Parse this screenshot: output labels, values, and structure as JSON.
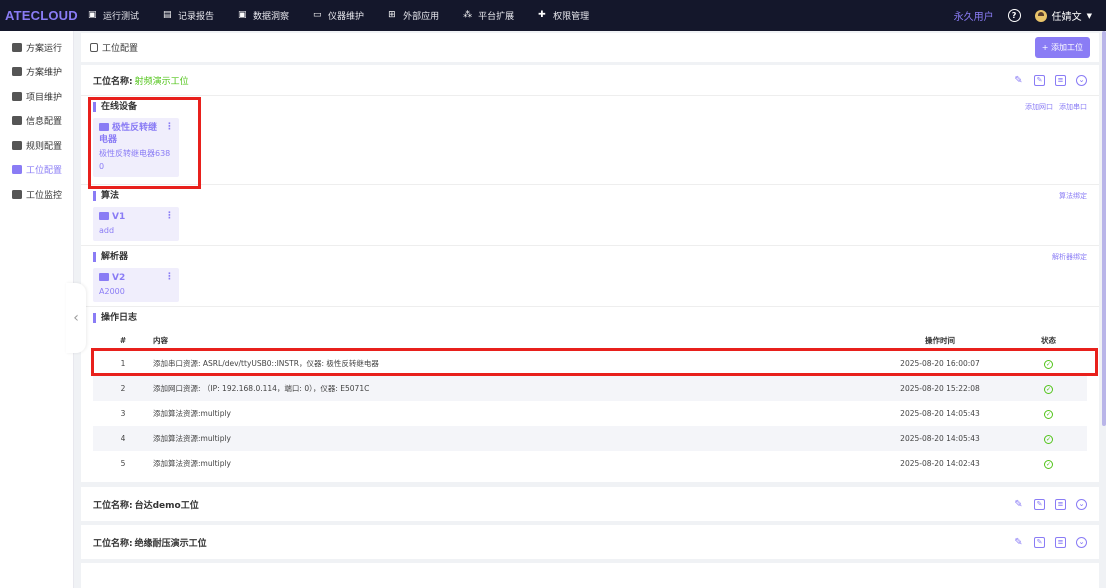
{
  "app": {
    "logo": "ATECLOUD"
  },
  "topnav": [
    {
      "label": "运行测试",
      "icon": "monitor-icon"
    },
    {
      "label": "记录报告",
      "icon": "document-icon"
    },
    {
      "label": "数据洞察",
      "icon": "chart-monitor-icon"
    },
    {
      "label": "仪器维护",
      "icon": "instrument-icon"
    },
    {
      "label": "外部应用",
      "icon": "grid-icon"
    },
    {
      "label": "平台扩展",
      "icon": "nodes-icon"
    },
    {
      "label": "权限管理",
      "icon": "plus-cluster-icon"
    }
  ],
  "user": {
    "type": "永久用户",
    "name": "任婧文"
  },
  "sidebar": [
    {
      "label": "方案运行",
      "active": false
    },
    {
      "label": "方案维护",
      "active": false
    },
    {
      "label": "项目维护",
      "active": false
    },
    {
      "label": "信息配置",
      "active": false
    },
    {
      "label": "规则配置",
      "active": false
    },
    {
      "label": "工位配置",
      "active": true
    },
    {
      "label": "工位监控",
      "active": false
    }
  ],
  "breadcrumb": {
    "label": "工位配置"
  },
  "add_station_label": "+ 添加工位",
  "station_label": "工位名称:",
  "stations": [
    {
      "name": "射频演示工位",
      "sections": {
        "online_devices": {
          "title": "在线设备",
          "links": [
            "添加网口",
            "添加串口"
          ],
          "card": {
            "title": "极性反转继电器",
            "sub": "极性反转继电器6380"
          }
        },
        "algorithm": {
          "title": "算法",
          "links": [
            "算法绑定"
          ],
          "card": {
            "title": "V1",
            "sub": "add"
          }
        },
        "parser": {
          "title": "解析器",
          "links": [
            "解析器绑定"
          ],
          "card": {
            "title": "V2",
            "sub": "A2000"
          }
        },
        "log": {
          "title": "操作日志",
          "columns": [
            "#",
            "内容",
            "操作时间",
            "状态"
          ],
          "rows": [
            {
              "no": "1",
              "content": "添加串口资源: ASRL/dev/ttyUSB0::INSTR，仪器: 极性反转继电器",
              "time": "2025-08-20 16:00:07"
            },
            {
              "no": "2",
              "content": "添加网口资源: （IP: 192.168.0.114，端口: 0），仪器: E5071C",
              "time": "2025-08-20 15:22:08"
            },
            {
              "no": "3",
              "content": "添加算法资源:multiply",
              "time": "2025-08-20 14:05:43"
            },
            {
              "no": "4",
              "content": "添加算法资源:multiply",
              "time": "2025-08-20 14:05:43"
            },
            {
              "no": "5",
              "content": "添加算法资源:multiply",
              "time": "2025-08-20 14:02:43"
            }
          ]
        }
      }
    },
    {
      "name": "台达demo工位"
    },
    {
      "name": "绝缘耐压演示工位"
    }
  ]
}
